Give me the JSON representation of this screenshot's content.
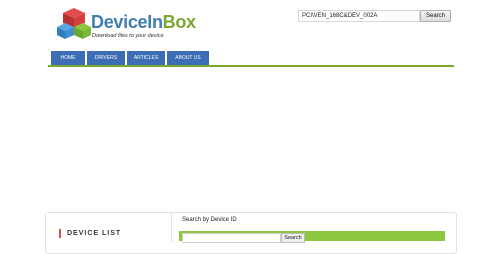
{
  "header": {
    "logo_prefix": "Device",
    "logo_middle": "In",
    "logo_suffix": "Box",
    "tagline": "Download files to your device",
    "search_value": "PCI\\VEN_168C&DEV_002A",
    "search_button": "Search"
  },
  "nav": {
    "items": [
      {
        "label": "HOME"
      },
      {
        "label": "DRIVERS"
      },
      {
        "label": "ARTICLES"
      },
      {
        "label": "ABOUT US"
      }
    ]
  },
  "sidebar": {
    "title": "DEVICE LIST"
  },
  "main": {
    "search_by_id_label": "Search by Device ID",
    "search_button": "Search"
  },
  "colors": {
    "nav_blue": "#3d6db4",
    "accent_green": "#7aa82f",
    "bar_green": "#8dc63f",
    "logo_blue": "#3f7fb0",
    "list_marker_red": "#d9534f"
  }
}
